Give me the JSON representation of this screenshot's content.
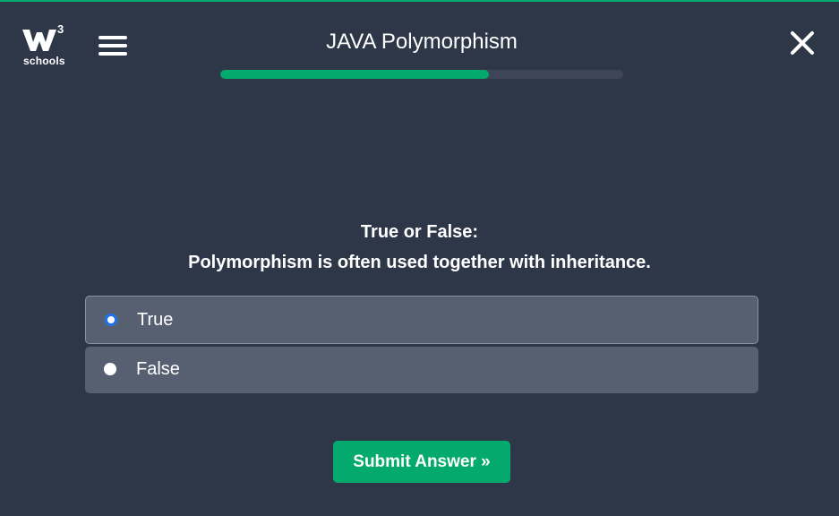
{
  "header": {
    "logo": {
      "superscript": "3",
      "text": "schools"
    },
    "title": "JAVA Polymorphism",
    "progress_fraction": 0.667
  },
  "question": {
    "line1": "True or False:",
    "line2": "Polymorphism is often used together with inheritance."
  },
  "options": [
    {
      "label": "True",
      "selected": true
    },
    {
      "label": "False",
      "selected": false
    }
  ],
  "submit_label": "Submit Answer »",
  "colors": {
    "accent": "#04aa6d",
    "background": "#2e3748",
    "option_bg": "#576071",
    "radio_selected": "#1d72f3"
  },
  "icons": {
    "menu": "hamburger-icon",
    "close": "close-icon",
    "logo": "w3schools-logo"
  }
}
